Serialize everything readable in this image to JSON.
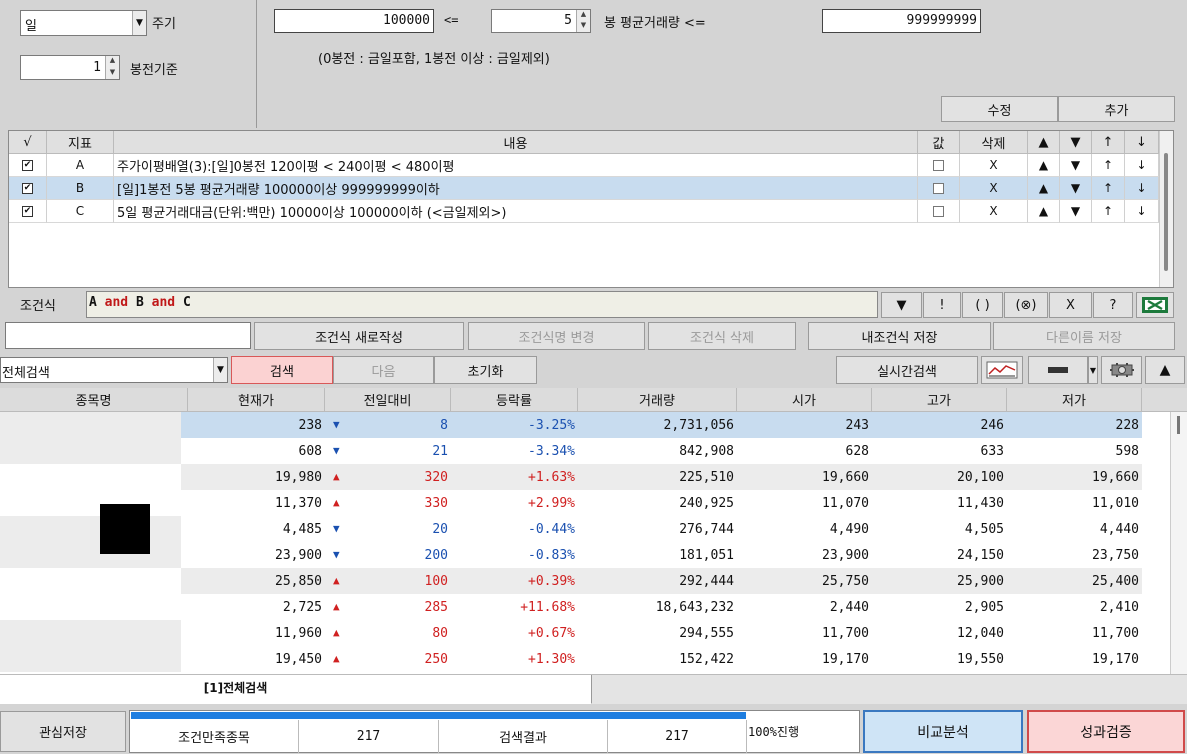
{
  "settings": {
    "period_value": "일",
    "period_label": "주기",
    "base_value": "1",
    "base_label": "봉전기준",
    "min_volume": "100000",
    "op1": "<=",
    "candle_count": "5",
    "avg_volume_label": "봉 평균거래량 <=",
    "max_volume": "999999999",
    "note": "(0봉전 : 금일포함, 1봉전 이상 : 금일제외)"
  },
  "edit_buttons": {
    "modify": "수정",
    "add": "추가"
  },
  "conditions": {
    "headers": {
      "check": "√",
      "indicator": "지표",
      "content": "내용",
      "value": "값",
      "delete": "삭제",
      "up_top": "▲",
      "down_bottom": "▼",
      "up": "↑",
      "down": "↓"
    },
    "rows": [
      {
        "id": "A",
        "checked": true,
        "content": "주가이평배열(3):[일]0봉전 120이평 < 240이평 < 480이평",
        "value_checked": false,
        "delete": "X",
        "selected": false
      },
      {
        "id": "B",
        "checked": true,
        "content": "[일]1봉전 5봉 평균거래량 100000이상 999999999이하",
        "value_checked": false,
        "delete": "X",
        "selected": true
      },
      {
        "id": "C",
        "checked": true,
        "content": "5일 평균거래대금(단위:백만) 10000이상 100000이하 (<금일제외>)",
        "value_checked": false,
        "delete": "X",
        "selected": false
      }
    ]
  },
  "formula": {
    "label": "조건식",
    "tokens": [
      {
        "text": "A",
        "kind": "id"
      },
      {
        "text": " and ",
        "kind": "op"
      },
      {
        "text": "B",
        "kind": "id"
      },
      {
        "text": " and ",
        "kind": "op"
      },
      {
        "text": "C",
        "kind": "id"
      }
    ],
    "tools": [
      "▼",
      "!",
      "( )",
      "(⊗)",
      "X",
      "?"
    ]
  },
  "formula_actions": {
    "name_input": "",
    "new": "조건식 새로작성",
    "rename": "조건식명 변경",
    "delete": "조건식 삭제",
    "save_mine": "내조건식 저장",
    "save_as": "다른이름 저장"
  },
  "search_bar": {
    "scope": "전체검색",
    "search": "검색",
    "next": "다음",
    "reset": "초기화",
    "realtime": "실시간검색"
  },
  "results": {
    "headers": {
      "name": "종목명",
      "price": "현재가",
      "change": "전일대비",
      "rate": "등락률",
      "volume": "거래량",
      "open": "시가",
      "high": "고가",
      "low": "저가"
    },
    "rows": [
      {
        "price": "238",
        "dir": "down",
        "change": "8",
        "rate": "-3.25%",
        "volume": "2,731,056",
        "open": "243",
        "high": "246",
        "low": "228"
      },
      {
        "price": "608",
        "dir": "down",
        "change": "21",
        "rate": "-3.34%",
        "volume": "842,908",
        "open": "628",
        "high": "633",
        "low": "598"
      },
      {
        "price": "19,980",
        "dir": "up",
        "change": "320",
        "rate": "+1.63%",
        "volume": "225,510",
        "open": "19,660",
        "high": "20,100",
        "low": "19,660"
      },
      {
        "price": "11,370",
        "dir": "up",
        "change": "330",
        "rate": "+2.99%",
        "volume": "240,925",
        "open": "11,070",
        "high": "11,430",
        "low": "11,010"
      },
      {
        "price": "4,485",
        "dir": "down",
        "change": "20",
        "rate": "-0.44%",
        "volume": "276,744",
        "open": "4,490",
        "high": "4,505",
        "low": "4,440"
      },
      {
        "price": "23,900",
        "dir": "down",
        "change": "200",
        "rate": "-0.83%",
        "volume": "181,051",
        "open": "23,900",
        "high": "24,150",
        "low": "23,750"
      },
      {
        "price": "25,850",
        "dir": "up",
        "change": "100",
        "rate": "+0.39%",
        "volume": "292,444",
        "open": "25,750",
        "high": "25,900",
        "low": "25,400"
      },
      {
        "price": "2,725",
        "dir": "up",
        "change": "285",
        "rate": "+11.68%",
        "volume": "18,643,232",
        "open": "2,440",
        "high": "2,905",
        "low": "2,410"
      },
      {
        "price": "11,960",
        "dir": "up",
        "change": "80",
        "rate": "+0.67%",
        "volume": "294,555",
        "open": "11,700",
        "high": "12,040",
        "low": "11,700"
      },
      {
        "price": "19,450",
        "dir": "up",
        "change": "250",
        "rate": "+1.30%",
        "volume": "152,422",
        "open": "19,170",
        "high": "19,550",
        "low": "19,170"
      }
    ]
  },
  "tabs": [
    {
      "label": "[1]전체검색"
    }
  ],
  "footer": {
    "save_interest": "관심저장",
    "matched_label": "조건만족종목",
    "matched_count": "217",
    "result_label": "검색결과",
    "result_count": "217",
    "progress_text": "100%진행",
    "progress": 1.0,
    "compare": "비교분석",
    "verify": "성과검증"
  },
  "colors": {
    "up": "#d02020",
    "down": "#1a50b0",
    "selected_row": "#c8dcef",
    "progress": "#1f7ee0",
    "keyword": "#c01818"
  }
}
